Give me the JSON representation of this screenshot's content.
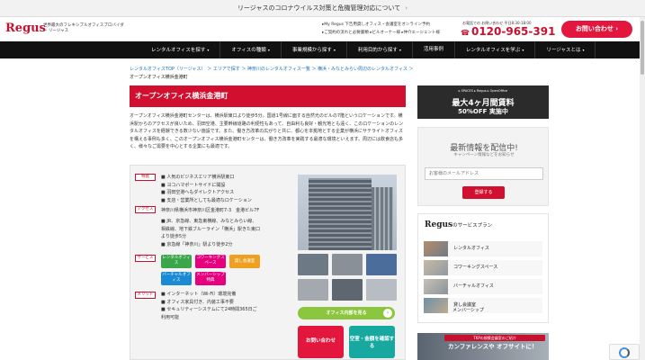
{
  "banner": {
    "text": "リージャスのコロナウイルス対策と危機管理対応について",
    "chevron": "›"
  },
  "header": {
    "logo": "Regus",
    "logo_sub": "世界最大のフレキシブルオフィスプロバイダー リージャス",
    "links_row1": "▸My Regus 下告用貸しオフィス・会議室をオンライン予約",
    "links_row2": "▸ご契約の流れと必要書類 ▸ビルオーナー様 ▸仲介エージェント様",
    "tel_label": "お電話での お問い合わせ 平日8:30-18:00",
    "tel": "0120-965-391",
    "contact": "お問い合わせ ›"
  },
  "nav": [
    "レンタルオフィスを探す",
    "オフィスの種類",
    "事業規模から探す",
    "利用目的から探す",
    "活用事例",
    "レンタルオフィスを学ぶ",
    "リージャスとは"
  ],
  "breadcrumbs": {
    "path": "レンタルオフィスTOP（リージャス） ＞ エリアで探す ＞ 神奈川のレンタルオフィス一覧 ＞ 横浜・みなとみらい周辺のレンタルオフィス ＞",
    "current": "オープンオフィス横浜金港町"
  },
  "title": "オープンオフィス横浜金港町",
  "description": "オープンオフィス横浜金港町センターは、横浜駅東口より徒歩5分。国道1号線に面する自然光のビルの7階というロケーションです。横浜駅からのアクセスが良いため、羽田空港、主要幹線道路の利便性もあって、自由利も良好・観光地とも遠く、このロケーションのレンタルオフィスを経験できる数少ない施設です。また、働き方改革の広がりと共に、都心を本拠地とする企業が横浜にサテライトオフィスを構える事例も多く、このオープンオフィス横浜金港町センターは、働き方改革を実践する最適な環境といえます。周辺には飲食店も多く、様々なご需要を中心とする企業にも最適です。",
  "card": {
    "tags": {
      "features": "特長",
      "access": "アクセス",
      "services": "サービス",
      "merits": "メリット"
    },
    "features": [
      "■ 人気のビジネスエリア横浜駅東口",
      "■ ヨコハマポートサイドに開設",
      "■ 羽田空港へもダイレクトアクセス",
      "■ 支店・営業所としても最適なロケーション"
    ],
    "address": "神奈川県横浜市神奈川区金港町7-3　金港ビル7F",
    "access": [
      "■ JR、京急線、東急東横線、みなとみらい線、相鉄線、地下鉄ブルーライン「横浜」駅きた東口より徒歩5分",
      "■ 京急線「神奈川」駅より徒歩2分"
    ],
    "services": [
      "レンタルオフィス",
      "コワーキングスペース",
      "貸し会議室",
      "バーチャルオフィス",
      "メンバーシップ特典"
    ],
    "merits": [
      "■ インターネット（Wi-Fi）環境完備",
      "■ オフィス家具付き、内装工事不要",
      "■ セキュリティーシステムにて24時間365日ご利用可能"
    ],
    "photo_button": "オフィス内部を見る",
    "photo_arrow": "›",
    "contact_button": "お問い合わせ",
    "vacancy_button": "空室・金額を確認する"
  },
  "sidebar": {
    "promo_row": "▸ SPACES ▸ Regus ▸ OpenOffice",
    "promo_big": "最大4ヶ月間賃料",
    "promo_pct": "50%OFF 実施中",
    "news_title": "最新情報を配信中!",
    "news_sub": "キャンペーン情報などをお知らせ",
    "email_placeholder": "お客様のメールアドレス",
    "register": "登録する",
    "plans_logo": "Regus",
    "plans_suffix": "のサービスプラン",
    "plans": [
      "レンタルオフィス",
      "コワーキングスペース",
      "バーチャルオフィス",
      "貸し会議室",
      "メンバーシップ"
    ],
    "conf_label": "TKPの規模会議室のご紹介",
    "conf_title": "カンファレンスや オフサイトに！"
  },
  "colors": {
    "brand_red": "#c8102e",
    "accent_red": "#e3173e",
    "green": "#8cc63f",
    "teal": "#17a8a0",
    "nav_bg": "#111111"
  }
}
